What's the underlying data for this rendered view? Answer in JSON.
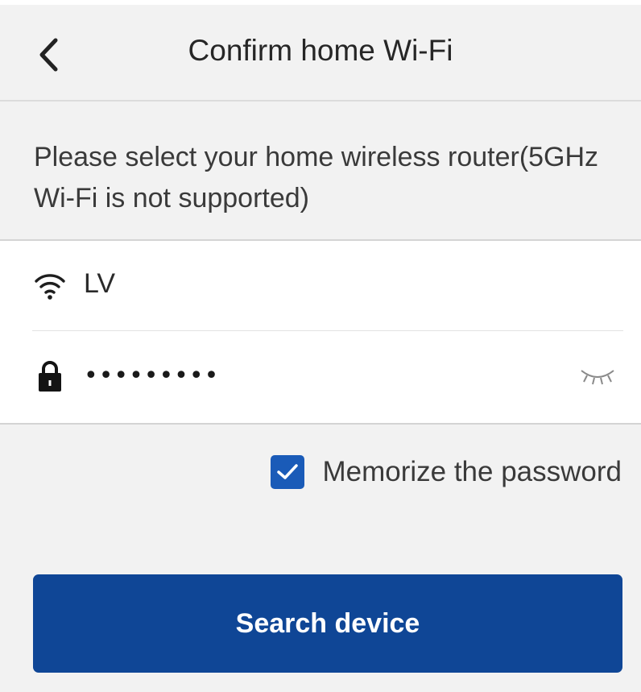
{
  "header": {
    "title": "Confirm home Wi-Fi",
    "back_icon": "chevron-left-icon"
  },
  "instruction": "Please select your home wireless router(5GHz\nWi-Fi is not supported)",
  "wifi": {
    "ssid_icon": "wifi-icon",
    "ssid": "LV",
    "password_icon": "lock-icon",
    "password_masked": "•••••••••",
    "visibility_icon": "eye-closed-icon"
  },
  "memorize": {
    "checked": true,
    "label": "Memorize the password"
  },
  "actions": {
    "search_label": "Search device"
  },
  "colors": {
    "background": "#f2f2f2",
    "card": "#ffffff",
    "primary": "#0f4696",
    "checkbox": "#1a5bb8"
  }
}
